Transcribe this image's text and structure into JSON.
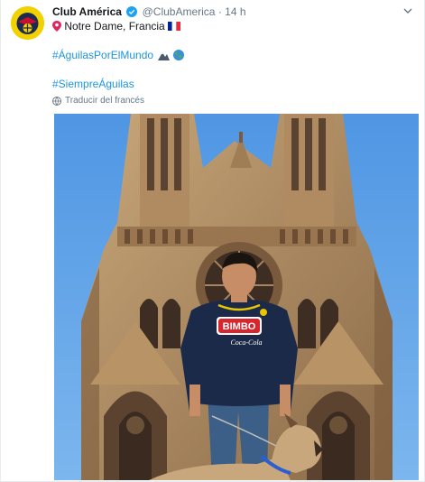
{
  "tweet": {
    "display_name": "Club América",
    "handle": "@ClubAmerica",
    "separator": "·",
    "time": "14 h",
    "location_text": "Notre Dame, Francia",
    "hashtag_1": "#ÁguilasPorElMundo",
    "hashtag_2": "#SiempreÁguilas",
    "translate_label": "Traducir del francés"
  },
  "photo": {
    "shirt_sponsor": "BIMBO",
    "shirt_brand": "Coca-Cola"
  },
  "colors": {
    "link": "#1b95e0",
    "muted": "#657786",
    "verified": "#1da1f2",
    "club_yellow": "#f2d100",
    "club_navy": "#1b2a52"
  },
  "icons": [
    "club-america-crest-icon",
    "verified-badge-icon",
    "chevron-down-icon",
    "location-pin-icon",
    "france-flag-icon",
    "mountain-icon",
    "globe-icon",
    "translate-globe-icon"
  ]
}
